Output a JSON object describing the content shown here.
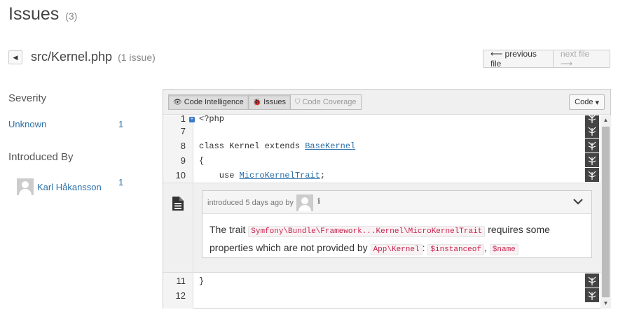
{
  "page": {
    "title": "Issues",
    "count": "(3)"
  },
  "file": {
    "back_glyph": "◀",
    "path": "src/Kernel.php",
    "issue_count": "(1 issue)",
    "prev_label": "⟵ previous file",
    "next_label": "next file ⟶"
  },
  "sidebar": {
    "severity_heading": "Severity",
    "severity": {
      "name": "Unknown",
      "count": "1"
    },
    "introduced_heading": "Introduced By",
    "author": {
      "name": "Karl Håkansson",
      "count": "1"
    }
  },
  "toolbar": {
    "code_intelligence": "Code Intelligence",
    "issues": "Issues",
    "code_coverage": "Code Coverage",
    "code_menu": "Code",
    "eye_glyph": "👁",
    "bug_glyph": "🐞",
    "shield_glyph": "⛉",
    "caret_glyph": "▾"
  },
  "code": {
    "lines": [
      {
        "num": "1",
        "src": "<?php"
      },
      {
        "num": "7",
        "src": ""
      },
      {
        "num": "8",
        "pre": "class Kernel extends ",
        "link": "BaseKernel"
      },
      {
        "num": "9",
        "src": "{"
      },
      {
        "num": "10",
        "pre": "    use ",
        "link": "MicroKernelTrait",
        "post": ";"
      },
      {
        "num": "11",
        "src": "}"
      },
      {
        "num": "12",
        "src": ""
      }
    ]
  },
  "issue": {
    "meta": "introduced 5 days ago by",
    "info_glyph": "ℹ",
    "text_1": "The trait ",
    "trait": "Symfony\\Bundle\\Framework...Kernel\\MicroKernelTrait",
    "text_2": " requires some properties which are not provided by ",
    "class_ref": "App\\Kernel",
    "colon": ": ",
    "prop_1": "$instanceof",
    "comma": ", ",
    "prop_2": "$name"
  },
  "colors": {
    "link": "#2a6fa8",
    "tag": "#c7254e",
    "action_icon_bg": "#444444"
  }
}
